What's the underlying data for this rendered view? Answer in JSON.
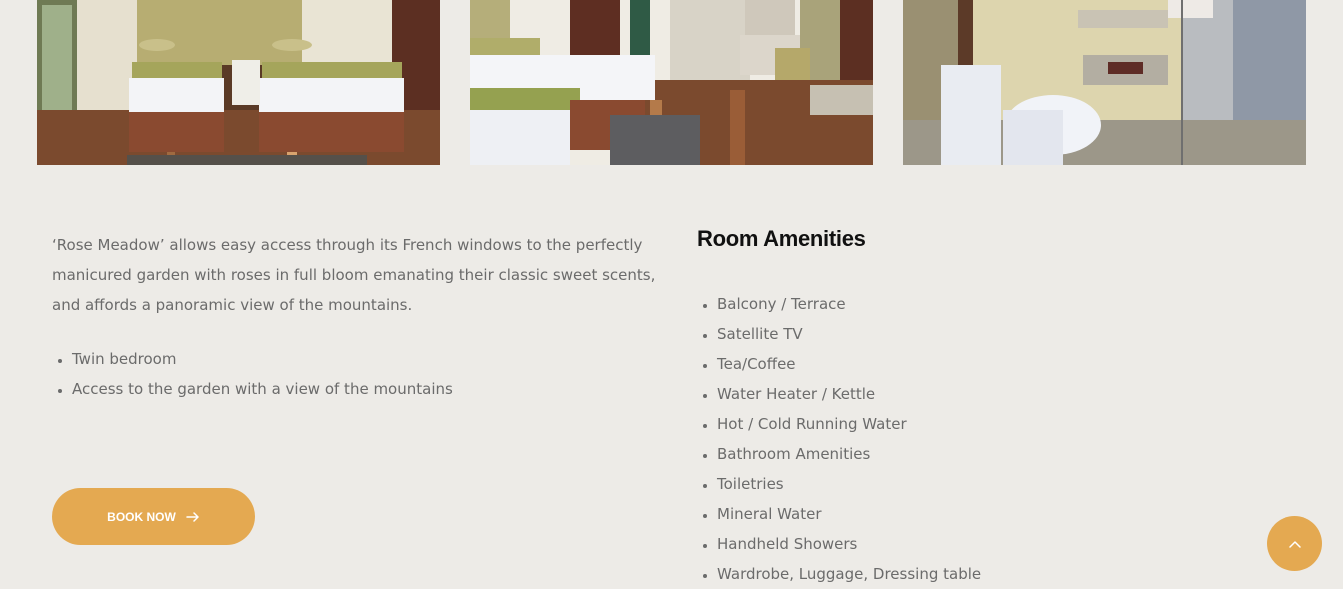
{
  "gallery": [
    {
      "name": "twin-bedroom-photo"
    },
    {
      "name": "room-interior-photo"
    },
    {
      "name": "bathroom-photo"
    }
  ],
  "description": "‘Rose Meadow’ allows easy access through its French windows to the perfectly manicured garden with roses in full bloom emanating their classic sweet scents, and affords a panoramic view of the mountains.",
  "features": [
    "Twin bedroom",
    "Access to the garden with a view of the mountains"
  ],
  "amenities": {
    "title": "Room Amenities",
    "items": [
      "Balcony / Terrace",
      "Satellite TV",
      "Tea/Coffee",
      "Water Heater / Kettle",
      "Hot / Cold Running Water",
      "Bathroom Amenities",
      "Toiletries",
      "Mineral Water",
      "Handheld Showers",
      "Wardrobe, Luggage, Dressing table"
    ]
  },
  "book_button": {
    "label": "BOOK NOW",
    "icon": "arrow-right-icon"
  },
  "scroll_top_button": {
    "icon": "chevron-up-icon"
  },
  "colors": {
    "accent": "#e4a951",
    "background": "#edebe7",
    "text": "#6b6b6b",
    "heading": "#111111"
  }
}
